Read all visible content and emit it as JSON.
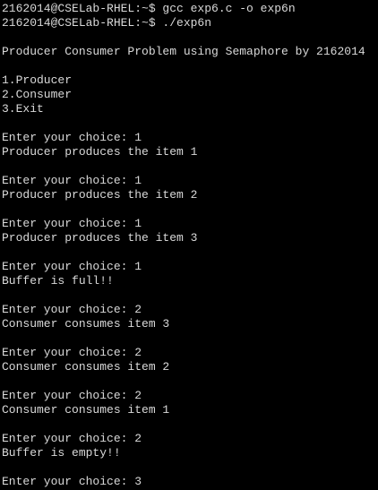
{
  "terminal": {
    "lines": [
      "2162014@CSELab-RHEL:~$ gcc exp6.c -o exp6n",
      "2162014@CSELab-RHEL:~$ ./exp6n",
      "",
      "Producer Consumer Problem using Semaphore by 2162014",
      "",
      "1.Producer",
      "2.Consumer",
      "3.Exit",
      "",
      "Enter your choice: 1",
      "Producer produces the item 1",
      "",
      "Enter your choice: 1",
      "Producer produces the item 2",
      "",
      "Enter your choice: 1",
      "Producer produces the item 3",
      "",
      "Enter your choice: 1",
      "Buffer is full!!",
      "",
      "Enter your choice: 2",
      "Consumer consumes item 3",
      "",
      "Enter your choice: 2",
      "Consumer consumes item 2",
      "",
      "Enter your choice: 2",
      "Consumer consumes item 1",
      "",
      "Enter your choice: 2",
      "Buffer is empty!!",
      "",
      "Enter your choice: 3"
    ],
    "foreground": "#d9d9d9",
    "background": "#000000"
  }
}
